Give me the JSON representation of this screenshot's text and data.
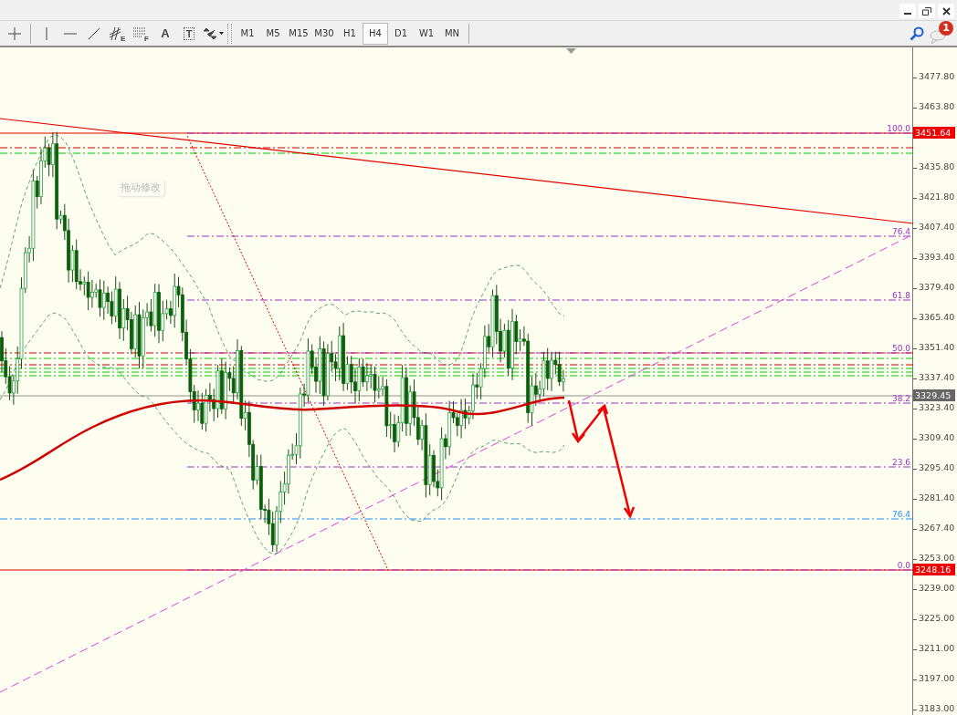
{
  "toolbar": {
    "tools": [
      {
        "kind": "crosshair"
      },
      {
        "kind": "vline"
      },
      {
        "kind": "hline"
      },
      {
        "kind": "trendline"
      },
      {
        "kind": "channel",
        "label": "E"
      },
      {
        "kind": "fibo",
        "label": "F"
      },
      {
        "kind": "text",
        "label": "A"
      },
      {
        "kind": "textlabel",
        "label": "T"
      },
      {
        "kind": "shapes"
      }
    ],
    "timeframes": [
      {
        "label": "M1",
        "selected": false
      },
      {
        "label": "M5",
        "selected": false
      },
      {
        "label": "M15",
        "selected": false
      },
      {
        "label": "M30",
        "selected": false
      },
      {
        "label": "H1",
        "selected": false
      },
      {
        "label": "H4",
        "selected": true
      },
      {
        "label": "D1",
        "selected": false
      },
      {
        "label": "W1",
        "selected": false
      },
      {
        "label": "MN",
        "selected": false
      }
    ]
  },
  "notifications": {
    "badge": "1"
  },
  "chart": {
    "tooltip": "拖动修改",
    "fib_levels": [
      {
        "label": "100.0",
        "kind": "retracement"
      },
      {
        "label": "76.4",
        "kind": "retracement"
      },
      {
        "label": "61.8",
        "kind": "retracement"
      },
      {
        "label": "50.0",
        "kind": "retracement"
      },
      {
        "label": "38.2",
        "kind": "retracement"
      },
      {
        "label": "23.6",
        "kind": "retracement"
      },
      {
        "label": "76.4",
        "kind": "expansion"
      },
      {
        "label": "0.0",
        "kind": "retracement"
      }
    ],
    "price_labels": [
      {
        "text": "3451.64",
        "kind": "line"
      },
      {
        "text": "3329.45",
        "kind": "bid"
      },
      {
        "text": "3248.16",
        "kind": "line"
      }
    ],
    "axis_ticks": [
      "3477.80",
      "3463.80",
      "3435.80",
      "3421.80",
      "3407.40",
      "3393.40",
      "3379.40",
      "3365.40",
      "3351.40",
      "3337.40",
      "3323.40",
      "3309.40",
      "3295.40",
      "3281.40",
      "3267.40",
      "3253.00",
      "3239.00",
      "3225.00",
      "3211.00",
      "3197.00",
      "3183.00"
    ]
  }
}
